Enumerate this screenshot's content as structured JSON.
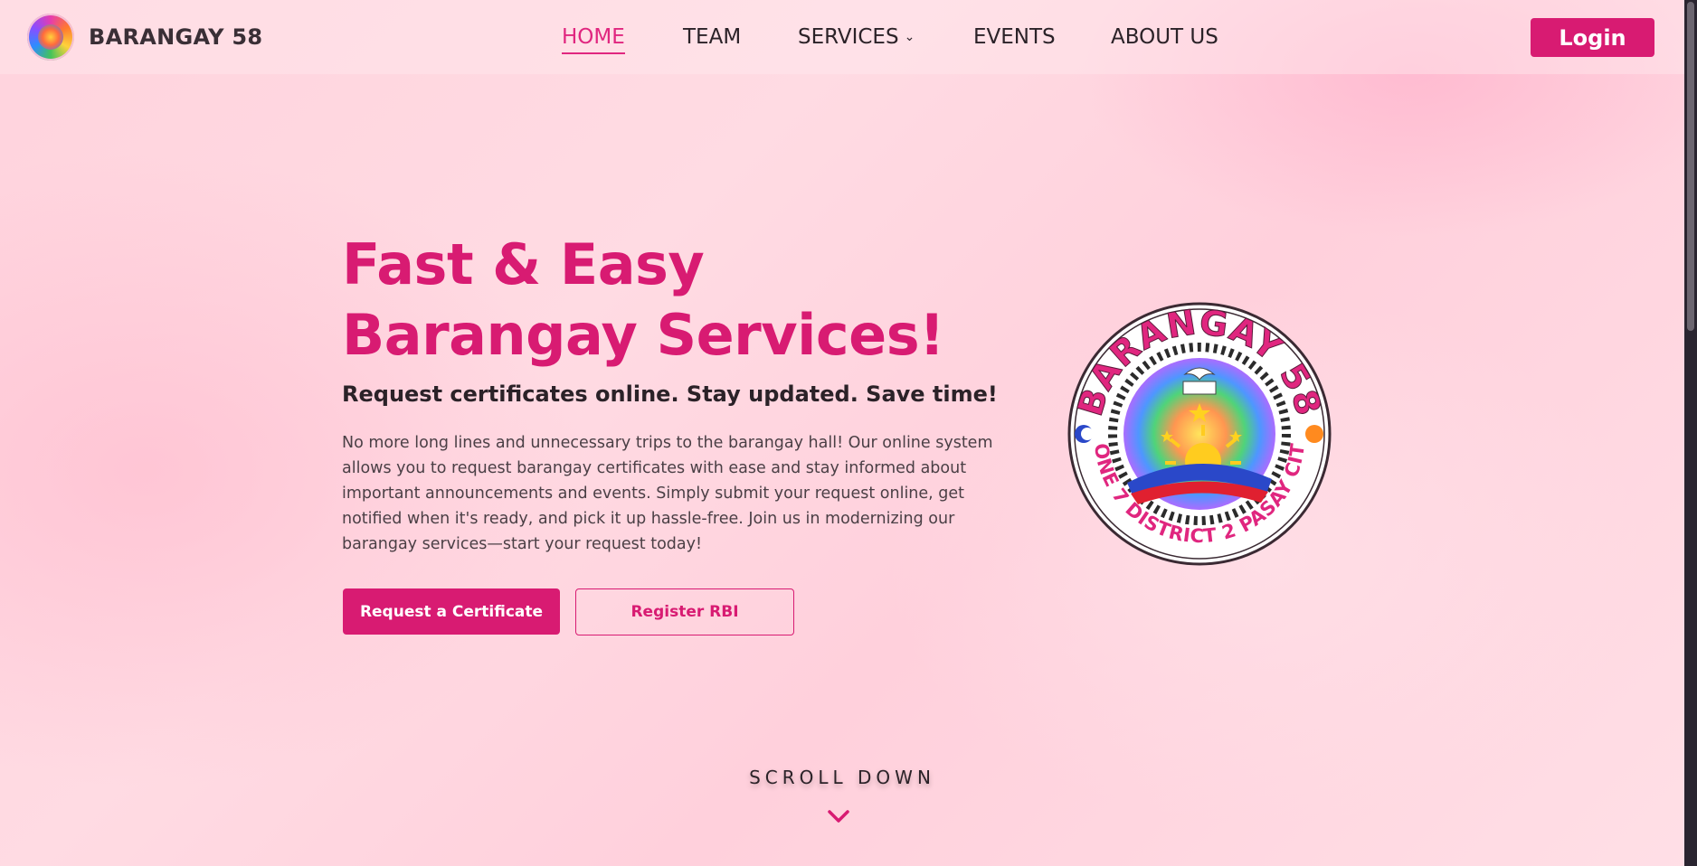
{
  "brand": {
    "name": "BARANGAY 58",
    "logo_icon": "barangay-seal-icon"
  },
  "nav": {
    "items": [
      {
        "label": "HOME",
        "active": true
      },
      {
        "label": "TEAM",
        "active": false
      },
      {
        "label": "SERVICES",
        "active": false,
        "dropdown": true
      },
      {
        "label": "EVENTS",
        "active": false
      },
      {
        "label": "ABOUT US",
        "active": false
      }
    ],
    "services_chevron": "⌄"
  },
  "login": {
    "label": "Login"
  },
  "hero": {
    "title_line1": "Fast & Easy",
    "title_line2": "Barangay Services!",
    "subtitle": "Request certificates online. Stay updated. Save time!",
    "description": "No more long lines and unnecessary trips to the barangay hall! Our online system allows you to request barangay certificates with ease and stay informed about important announcements and events. Simply submit your request online, get notified when it's ready, and pick it up hassle-free. Join us in modernizing our barangay services—start your request today!",
    "primary_button": "Request a Certificate",
    "secondary_button": "Register RBI"
  },
  "seal": {
    "top_text": "BARANGAY 58",
    "bottom_text": "ZONE 7 DISTRICT 2 PASAY CITY"
  },
  "scroll": {
    "label": "SCROLL DOWN",
    "icon": "chevron-down-icon"
  },
  "colors": {
    "accent": "#d81b72",
    "nav_active": "#e0267f",
    "text_dark": "#2b2228",
    "background": "#ffd6df"
  }
}
